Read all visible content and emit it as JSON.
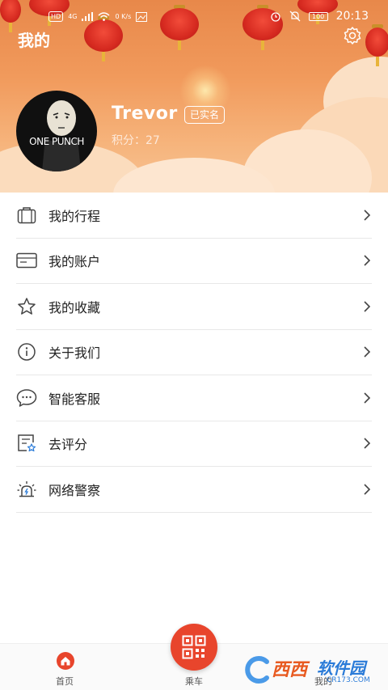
{
  "status_bar": {
    "signal_badge": "HD",
    "network": "4G",
    "speed_value": "0",
    "speed_unit": "K/s",
    "battery": "100",
    "time": "20:13"
  },
  "header": {
    "title": "我的",
    "settings_icon": "gear-icon"
  },
  "profile": {
    "avatar_text": "ONE PUNCH",
    "name": "Trevor",
    "verified_label": "已实名",
    "points": "积分：27"
  },
  "menu": {
    "items": [
      {
        "label": "我的行程",
        "icon": "suitcase-icon"
      },
      {
        "label": "我的账户",
        "icon": "card-icon"
      },
      {
        "label": "我的收藏",
        "icon": "star-icon"
      },
      {
        "label": "关于我们",
        "icon": "info-icon"
      },
      {
        "label": "智能客服",
        "icon": "chat-icon"
      },
      {
        "label": "去评分",
        "icon": "rating-icon"
      },
      {
        "label": "网络警察",
        "icon": "police-light-icon"
      }
    ]
  },
  "bottom_nav": {
    "home_label": "首页",
    "ride_label": "乘车",
    "mine_label": "我的"
  },
  "watermark": {
    "brand": "西西",
    "brand2": "软件园",
    "domain": "CR173.COM"
  },
  "colors": {
    "accent": "#e8452c",
    "header_top": "#e8884a",
    "header_bottom": "#f8c394"
  }
}
